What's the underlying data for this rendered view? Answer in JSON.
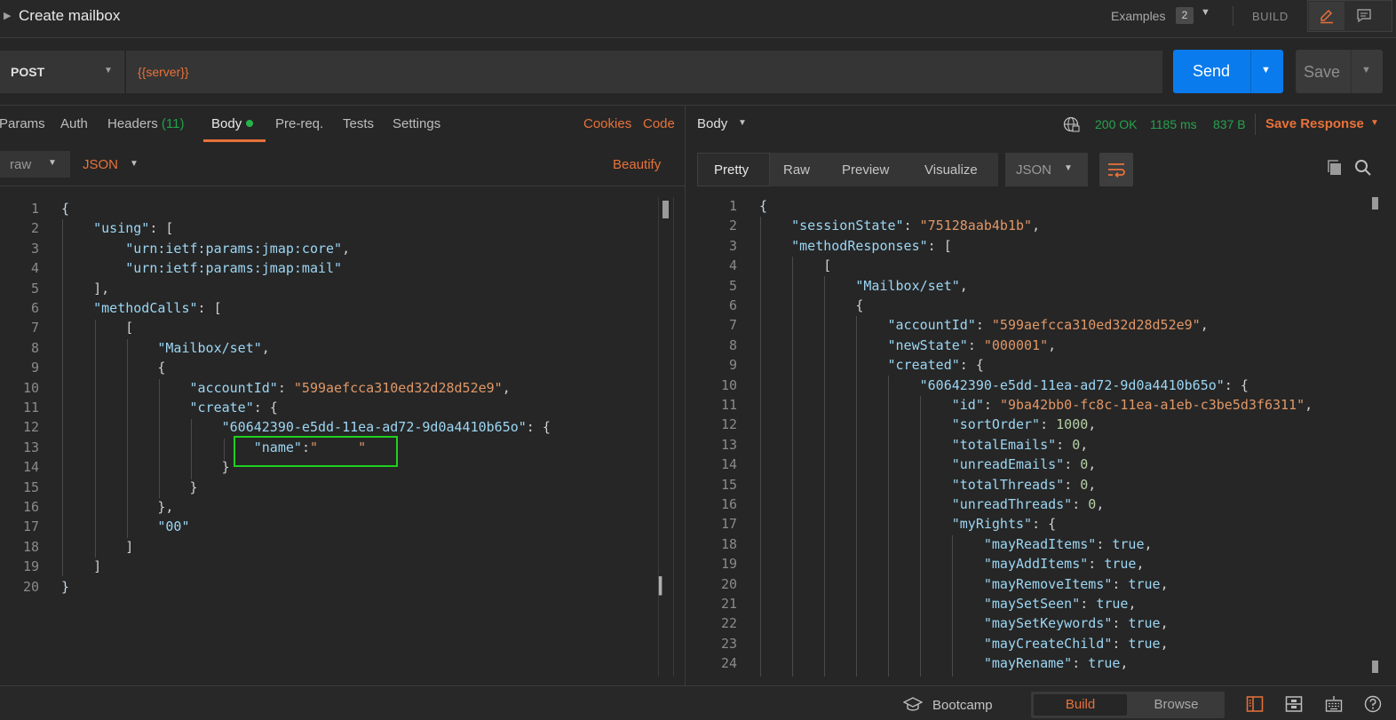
{
  "title_bar": {
    "title": "Create mailbox",
    "examples_label": "Examples",
    "examples_count": "2",
    "build_label": "BUILD",
    "expand_icon": "triangle-right-icon",
    "edit_icon": "pencil-icon",
    "comment_icon": "comment-icon"
  },
  "request": {
    "method": "POST",
    "url": "{{server}}",
    "send_label": "Send",
    "save_label": "Save"
  },
  "request_tabs": {
    "params": "Params",
    "auth": "Auth",
    "headers": "Headers",
    "headers_count": "(11)",
    "body": "Body",
    "prereq": "Pre-req.",
    "tests": "Tests",
    "settings": "Settings",
    "cookies": "Cookies",
    "code": "Code"
  },
  "body_options": {
    "mode": "raw",
    "language": "JSON",
    "beautify": "Beautify"
  },
  "request_body": {
    "line_numbers": [
      "1",
      "2",
      "3",
      "4",
      "5",
      "6",
      "7",
      "8",
      "9",
      "10",
      "11",
      "12",
      "13",
      "14",
      "15",
      "16",
      "17",
      "18",
      "19",
      "20"
    ],
    "lines": [
      [
        [
          "b",
          "{"
        ]
      ],
      [
        [
          "p",
          "    "
        ],
        [
          "k",
          "\"using\""
        ],
        [
          "p",
          ": ["
        ]
      ],
      [
        [
          "p",
          "        "
        ],
        [
          "k",
          "\"urn:ietf:params:jmap:core\""
        ],
        [
          "p",
          ","
        ]
      ],
      [
        [
          "p",
          "        "
        ],
        [
          "k",
          "\"urn:ietf:params:jmap:mail\""
        ]
      ],
      [
        [
          "p",
          "    ],"
        ]
      ],
      [
        [
          "p",
          "    "
        ],
        [
          "k",
          "\"methodCalls\""
        ],
        [
          "p",
          ": ["
        ]
      ],
      [
        [
          "p",
          "        ["
        ]
      ],
      [
        [
          "p",
          "            "
        ],
        [
          "k",
          "\"Mailbox/set\""
        ],
        [
          "p",
          ","
        ]
      ],
      [
        [
          "p",
          "            {"
        ]
      ],
      [
        [
          "p",
          "                "
        ],
        [
          "k",
          "\"accountId\""
        ],
        [
          "p",
          ": "
        ],
        [
          "s",
          "\"599aefcca310ed32d28d52e9\""
        ],
        [
          "p",
          ","
        ]
      ],
      [
        [
          "p",
          "                "
        ],
        [
          "k",
          "\"create\""
        ],
        [
          "p",
          ": {"
        ]
      ],
      [
        [
          "p",
          "                    "
        ],
        [
          "k",
          "\"60642390-e5dd-11ea-ad72-9d0a4410b65o\""
        ],
        [
          "p",
          ": {"
        ]
      ],
      [
        [
          "p",
          "                        "
        ],
        [
          "k",
          "\"name\""
        ],
        [
          "p",
          ":"
        ],
        [
          "s",
          "\"     \""
        ]
      ],
      [
        [
          "p",
          "                    }"
        ]
      ],
      [
        [
          "p",
          "                }"
        ]
      ],
      [
        [
          "p",
          "            },"
        ]
      ],
      [
        [
          "p",
          "            "
        ],
        [
          "k",
          "\"00\""
        ]
      ],
      [
        [
          "p",
          "        ]"
        ]
      ],
      [
        [
          "p",
          "    ]"
        ]
      ],
      [
        [
          "b",
          "}"
        ]
      ]
    ]
  },
  "response_header": {
    "body_label": "Body",
    "status": "200 OK",
    "time": "1185 ms",
    "size": "837 B",
    "save_response": "Save Response"
  },
  "response_toolbar": {
    "pretty": "Pretty",
    "raw": "Raw",
    "preview": "Preview",
    "visualize": "Visualize",
    "format": "JSON"
  },
  "response_body": {
    "line_numbers": [
      "1",
      "2",
      "3",
      "4",
      "5",
      "6",
      "7",
      "8",
      "9",
      "10",
      "11",
      "12",
      "13",
      "14",
      "15",
      "16",
      "17",
      "18",
      "19",
      "20",
      "21",
      "22",
      "23",
      "24"
    ],
    "lines": [
      [
        [
          "b",
          "{"
        ]
      ],
      [
        [
          "p",
          "    "
        ],
        [
          "k",
          "\"sessionState\""
        ],
        [
          "p",
          ": "
        ],
        [
          "s",
          "\"75128aab4b1b\""
        ],
        [
          "p",
          ","
        ]
      ],
      [
        [
          "p",
          "    "
        ],
        [
          "k",
          "\"methodResponses\""
        ],
        [
          "p",
          ": ["
        ]
      ],
      [
        [
          "p",
          "        ["
        ]
      ],
      [
        [
          "p",
          "            "
        ],
        [
          "k",
          "\"Mailbox/set\""
        ],
        [
          "p",
          ","
        ]
      ],
      [
        [
          "p",
          "            {"
        ]
      ],
      [
        [
          "p",
          "                "
        ],
        [
          "k",
          "\"accountId\""
        ],
        [
          "p",
          ": "
        ],
        [
          "s",
          "\"599aefcca310ed32d28d52e9\""
        ],
        [
          "p",
          ","
        ]
      ],
      [
        [
          "p",
          "                "
        ],
        [
          "k",
          "\"newState\""
        ],
        [
          "p",
          ": "
        ],
        [
          "s",
          "\"000001\""
        ],
        [
          "p",
          ","
        ]
      ],
      [
        [
          "p",
          "                "
        ],
        [
          "k",
          "\"created\""
        ],
        [
          "p",
          ": {"
        ]
      ],
      [
        [
          "p",
          "                    "
        ],
        [
          "k",
          "\"60642390-e5dd-11ea-ad72-9d0a4410b65o\""
        ],
        [
          "p",
          ": {"
        ]
      ],
      [
        [
          "p",
          "                        "
        ],
        [
          "k",
          "\"id\""
        ],
        [
          "p",
          ": "
        ],
        [
          "s",
          "\"9ba42bb0-fc8c-11ea-a1eb-c3be5d3f6311\""
        ],
        [
          "p",
          ","
        ]
      ],
      [
        [
          "p",
          "                        "
        ],
        [
          "k",
          "\"sortOrder\""
        ],
        [
          "p",
          ": "
        ],
        [
          "n",
          "1000"
        ],
        [
          "p",
          ","
        ]
      ],
      [
        [
          "p",
          "                        "
        ],
        [
          "k",
          "\"totalEmails\""
        ],
        [
          "p",
          ": "
        ],
        [
          "n",
          "0"
        ],
        [
          "p",
          ","
        ]
      ],
      [
        [
          "p",
          "                        "
        ],
        [
          "k",
          "\"unreadEmails\""
        ],
        [
          "p",
          ": "
        ],
        [
          "n",
          "0"
        ],
        [
          "p",
          ","
        ]
      ],
      [
        [
          "p",
          "                        "
        ],
        [
          "k",
          "\"totalThreads\""
        ],
        [
          "p",
          ": "
        ],
        [
          "n",
          "0"
        ],
        [
          "p",
          ","
        ]
      ],
      [
        [
          "p",
          "                        "
        ],
        [
          "k",
          "\"unreadThreads\""
        ],
        [
          "p",
          ": "
        ],
        [
          "n",
          "0"
        ],
        [
          "p",
          ","
        ]
      ],
      [
        [
          "p",
          "                        "
        ],
        [
          "k",
          "\"myRights\""
        ],
        [
          "p",
          ": {"
        ]
      ],
      [
        [
          "p",
          "                            "
        ],
        [
          "k",
          "\"mayReadItems\""
        ],
        [
          "p",
          ": "
        ],
        [
          "k",
          "true"
        ],
        [
          "p",
          ","
        ]
      ],
      [
        [
          "p",
          "                            "
        ],
        [
          "k",
          "\"mayAddItems\""
        ],
        [
          "p",
          ": "
        ],
        [
          "k",
          "true"
        ],
        [
          "p",
          ","
        ]
      ],
      [
        [
          "p",
          "                            "
        ],
        [
          "k",
          "\"mayRemoveItems\""
        ],
        [
          "p",
          ": "
        ],
        [
          "k",
          "true"
        ],
        [
          "p",
          ","
        ]
      ],
      [
        [
          "p",
          "                            "
        ],
        [
          "k",
          "\"maySetSeen\""
        ],
        [
          "p",
          ": "
        ],
        [
          "k",
          "true"
        ],
        [
          "p",
          ","
        ]
      ],
      [
        [
          "p",
          "                            "
        ],
        [
          "k",
          "\"maySetKeywords\""
        ],
        [
          "p",
          ": "
        ],
        [
          "k",
          "true"
        ],
        [
          "p",
          ","
        ]
      ],
      [
        [
          "p",
          "                            "
        ],
        [
          "k",
          "\"mayCreateChild\""
        ],
        [
          "p",
          ": "
        ],
        [
          "k",
          "true"
        ],
        [
          "p",
          ","
        ]
      ],
      [
        [
          "p",
          "                            "
        ],
        [
          "k",
          "\"mayRename\""
        ],
        [
          "p",
          ": "
        ],
        [
          "k",
          "true"
        ],
        [
          "p",
          ","
        ]
      ]
    ]
  },
  "footer": {
    "bootcamp": "Bootcamp",
    "build": "Build",
    "browse": "Browse"
  },
  "colors": {
    "accent_orange": "#e8723a",
    "send_blue": "#097bed",
    "status_green": "#27a24e",
    "highlight_green": "#1fd01f"
  }
}
